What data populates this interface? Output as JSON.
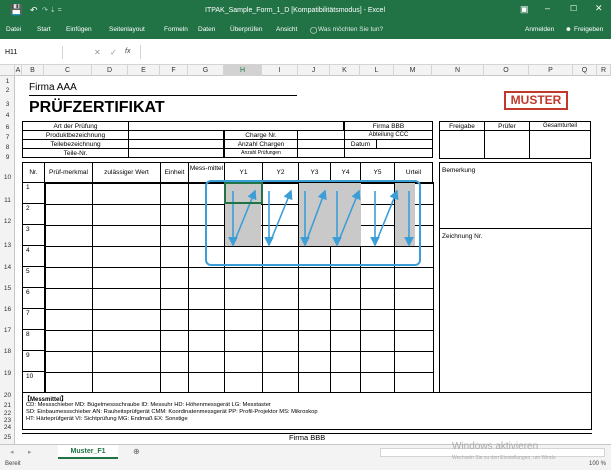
{
  "window": {
    "title": "ITPAK_Sample_Form_1_D [Kompatibilitätsmodus] - Excel",
    "quick_redo": "↷ ⇣ ="
  },
  "ribbon": {
    "tabs": [
      "Datei",
      "Start",
      "Einfügen",
      "Seitenlayout",
      "Formeln",
      "Daten",
      "Überprüfen",
      "Ansicht"
    ],
    "tell_me": "Was möchten Sie tun?",
    "signin": "Anmelden",
    "share": "Freigeben"
  },
  "formula_bar": {
    "name_box": "H11",
    "fx": "fx",
    "value": ""
  },
  "columns": [
    "A",
    "B",
    "C",
    "D",
    "E",
    "F",
    "G",
    "H",
    "I",
    "J",
    "K",
    "L",
    "M",
    "N",
    "O",
    "P",
    "Q",
    "R"
  ],
  "rows": [
    "1",
    "2",
    "3",
    "4",
    "6",
    "7",
    "8",
    "9",
    "10",
    "11",
    "12",
    "13",
    "14",
    "15",
    "16",
    "17",
    "18",
    "19",
    "20",
    "21",
    "22",
    "23",
    "24",
    "25"
  ],
  "form": {
    "company": "Firma AAA",
    "title": "PRÜFZERTIFIKAT",
    "stamp": "MUSTER",
    "hdr_art": "Art der Prüfung",
    "hdr_produkt": "Produktbezeichnung",
    "hdr_teile": "Teilebezeichnung",
    "hdr_teilenr": "Teile-Nr.",
    "firma_bbb": "Firma BBB",
    "abteilung": "Abteilung CCC",
    "datum": "Datum",
    "charge": "Charge Nr.",
    "anzahl_chargen": "Anzahl Chargen",
    "anzahl_pruefungen": "Anzahl Prüfungen",
    "freigabe": "Freigabe",
    "pruefer": "Prüfer",
    "gesamturteil": "Gesamturteil",
    "col_nr": "Nr.",
    "col_merkmal": "Prüf-merkmal",
    "col_wert": "zulässiger Wert",
    "col_einheit": "Einheit",
    "col_mess": "Mess-mittel",
    "y_cols": [
      "Y1",
      "Y2",
      "Y3",
      "Y4",
      "Y5"
    ],
    "col_urteil": "Urteil",
    "bemerkung": "Bemerkung",
    "zeichnung": "Zeichnung Nr.",
    "row_nums": [
      "1",
      "2",
      "3",
      "4",
      "5",
      "6",
      "7",
      "8",
      "9",
      "10"
    ],
    "messmittel_hdr": "【Messmittel】",
    "legend1": "CD: Messschieber MD: Bügelmessschraube ID: Messuhr HD: Höhenmessgerät LG: Messtaster",
    "legend2": "SD: Einbaumessschieber AN: Rauheitsprüfgerät CMM: Koordinatenmessgerät PP: Profil-Projektor MS: Mikroskop",
    "legend3": "HT: Härteprüfgerät VI: Sichtprüfung MG: Endmaß EX: Sonstige",
    "footer": "Firma BBB"
  },
  "sheet_tabs": {
    "active": "Muster_F1",
    "add": "⊕"
  },
  "status": {
    "ready": "Bereit",
    "watermark1": "Windows aktivieren",
    "watermark2": "Wechseln Sie zu den Einstellungen, um Windo",
    "zoom": "100 %"
  },
  "colors": {
    "excel_green": "#217346",
    "stamp_red": "#c0392b",
    "highlight": "#3c9ed6"
  }
}
